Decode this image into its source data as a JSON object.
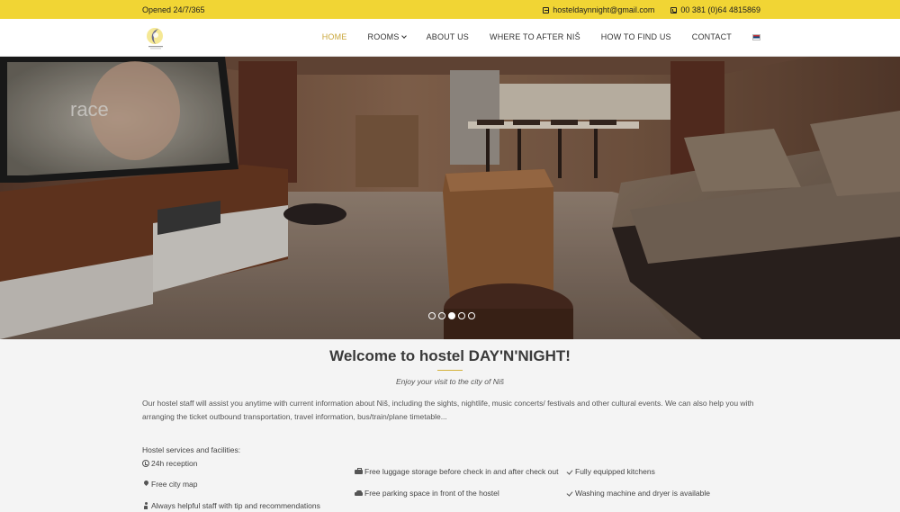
{
  "topbar": {
    "hours": "Opened 24/7/365",
    "email": "hosteldaynnight@gmail.com",
    "phone": "00 381 (0)64 4815869"
  },
  "nav": {
    "items": [
      {
        "label": "HOME",
        "active": true
      },
      {
        "label": "ROOMS",
        "dropdown": true
      },
      {
        "label": "ABOUT US"
      },
      {
        "label": "WHERE TO AFTER NIŠ"
      },
      {
        "label": "HOW TO FIND US"
      },
      {
        "label": "CONTACT"
      }
    ],
    "language_flag": "serbia-flag-icon"
  },
  "hero": {
    "tv_text": "race",
    "slides_total": 5,
    "active_slide": 3
  },
  "welcome": {
    "title": "Welcome to hostel DAY'N'NIGHT!",
    "subtitle": "Enjoy your visit to the city of Niš",
    "intro": "Our hostel staff will assist you anytime with current information about Niš, including the sights, nightlife, music concerts/ festivals and other cultural events. We can also help you with arranging the ticket outbound transportation, travel information, bus/train/plane timetable..."
  },
  "services": {
    "heading": "Hostel services and facilities:",
    "col1": [
      {
        "icon": "clock-icon",
        "text": "24h reception"
      },
      {
        "icon": "map-pin-icon",
        "text": "Free city map"
      },
      {
        "icon": "person-icon",
        "text": "Always helpful staff with tip and recommendations"
      }
    ],
    "col2": [
      {
        "icon": "suitcase-icon",
        "text": "Free luggage storage before check in and after check out"
      },
      {
        "icon": "car-icon",
        "text": "Free parking space in front of the hostel"
      }
    ],
    "col3": [
      {
        "icon": "check-icon",
        "text": "Fully equipped kitchens"
      },
      {
        "icon": "check-icon",
        "text": "Washing machine and dryer is available"
      }
    ]
  },
  "colors": {
    "accent_yellow": "#f1d534",
    "active_nav": "#c9a63a"
  }
}
